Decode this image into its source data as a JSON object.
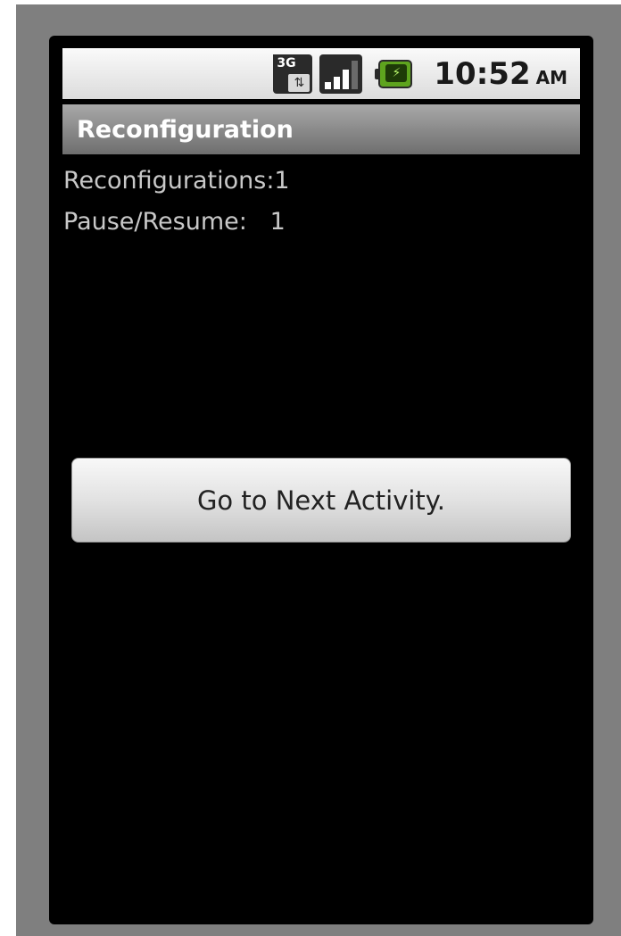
{
  "status_bar": {
    "network_type": "3G",
    "data_icon": "data-transfer-arrows",
    "signal_icon": "signal-strength-bars",
    "battery_icon": "battery-charging",
    "time": "10:52",
    "ampm": "AM"
  },
  "title_bar": {
    "title": "Reconfiguration"
  },
  "stats": {
    "reconfigurations_label": "Reconfigurations:",
    "reconfigurations_value": "1",
    "pause_resume_label": "Pause/Resume:   ",
    "pause_resume_value": "1"
  },
  "actions": {
    "next_button_label": "Go to Next Activity."
  },
  "colors": {
    "background": "#000000",
    "frame": "#7f7f7f",
    "title_bar": "#8a8a8a",
    "text": "#c8c8c8",
    "battery": "#5ea41e"
  }
}
